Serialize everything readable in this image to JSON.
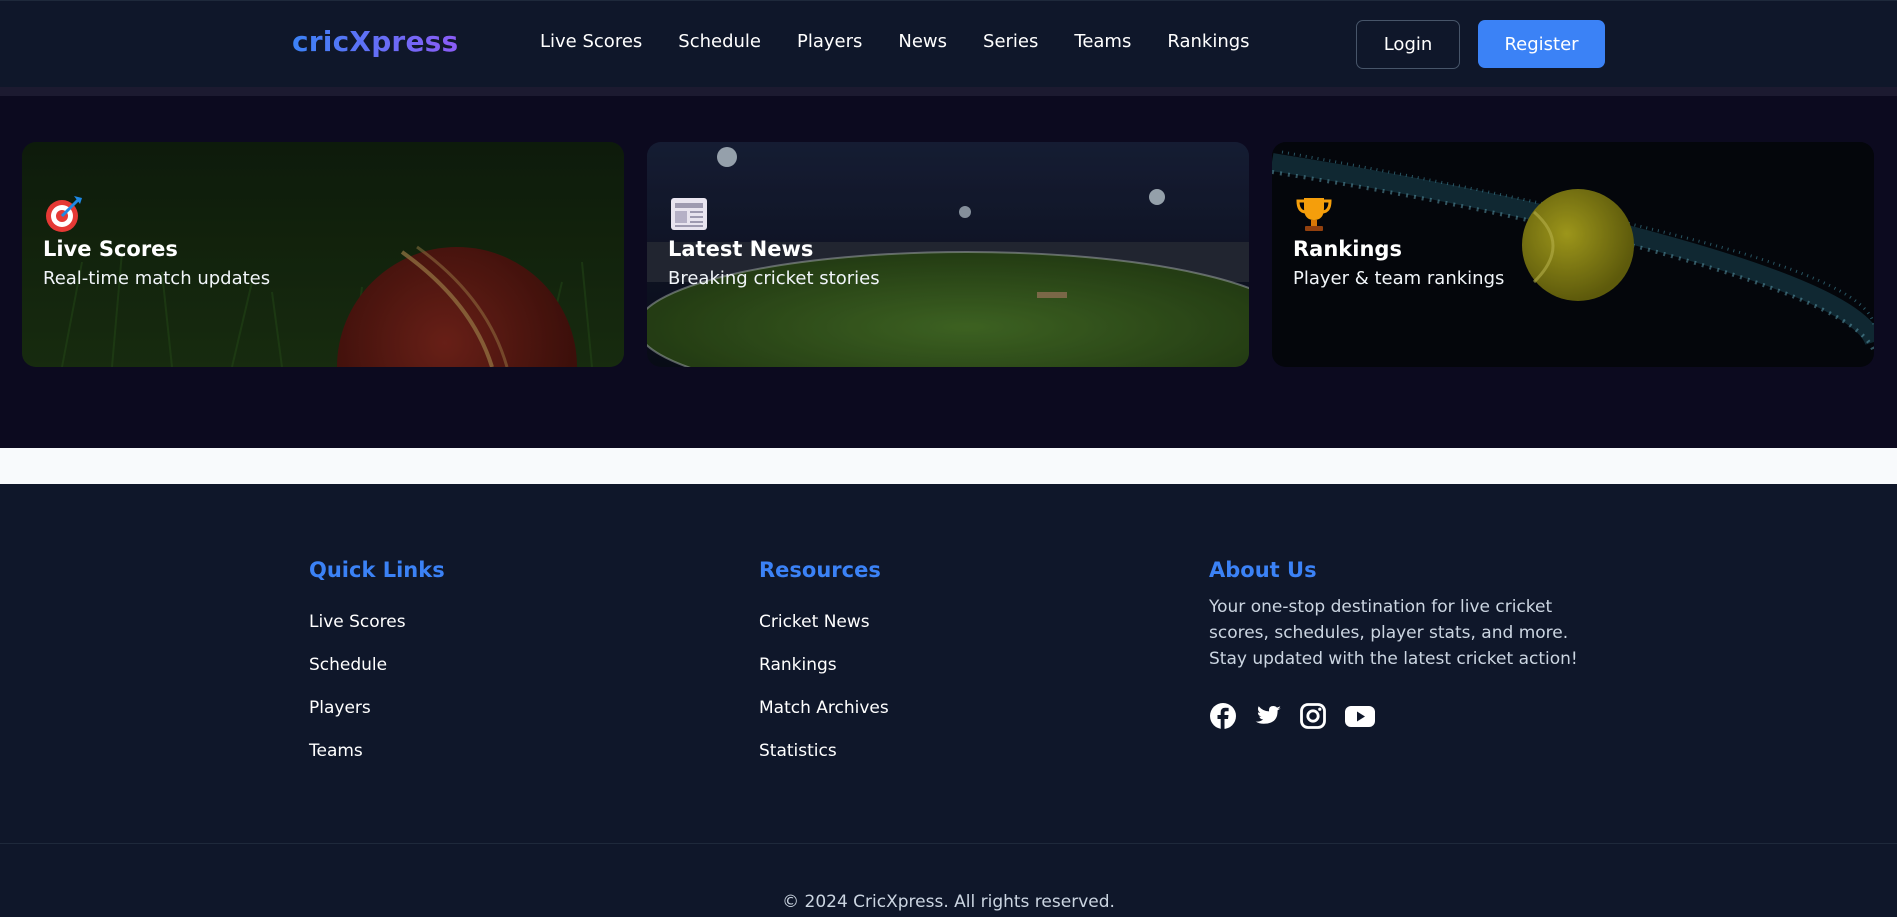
{
  "header": {
    "logo": "cricXpress",
    "nav": [
      "Live Scores",
      "Schedule",
      "Players",
      "News",
      "Series",
      "Teams",
      "Rankings"
    ],
    "login_label": "Login",
    "register_label": "Register"
  },
  "cards": [
    {
      "icon": "target-icon",
      "title": "Live Scores",
      "subtitle": "Real-time match updates"
    },
    {
      "icon": "newspaper-icon",
      "title": "Latest News",
      "subtitle": "Breaking cricket stories"
    },
    {
      "icon": "trophy-icon",
      "title": "Rankings",
      "subtitle": "Player & team rankings"
    }
  ],
  "footer": {
    "quick_links": {
      "heading": "Quick Links",
      "items": [
        "Live Scores",
        "Schedule",
        "Players",
        "Teams"
      ]
    },
    "resources": {
      "heading": "Resources",
      "items": [
        "Cricket News",
        "Rankings",
        "Match Archives",
        "Statistics"
      ]
    },
    "about": {
      "heading": "About Us",
      "text": "Your one-stop destination for live cricket scores, schedules, player stats, and more. Stay updated with the latest cricket action!",
      "socials": [
        "facebook-icon",
        "twitter-icon",
        "instagram-icon",
        "youtube-icon"
      ]
    },
    "copyright": "© 2024 CricXpress. All rights reserved."
  },
  "colors": {
    "accent": "#3b82f6",
    "logo_gradient_end": "#8b5cf6",
    "page_bg": "#0f172a",
    "band_bg": "#0c0a1f"
  }
}
